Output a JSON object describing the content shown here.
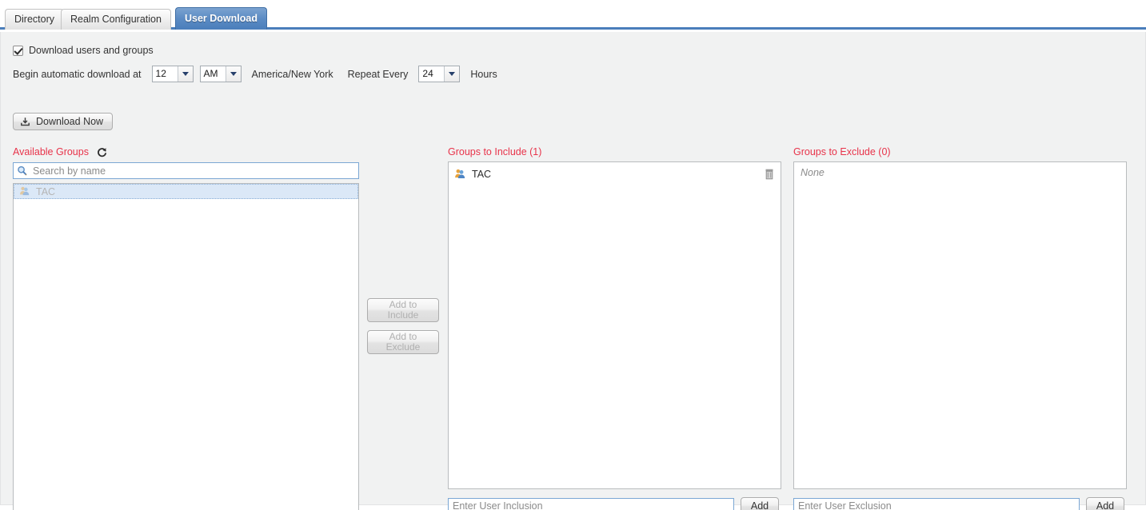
{
  "tabs": [
    {
      "label": "Directory",
      "active": false
    },
    {
      "label": "Realm Configuration",
      "active": false
    },
    {
      "label": "User Download",
      "active": true
    }
  ],
  "options": {
    "download_checkbox_label": "Download users and groups",
    "download_checkbox_checked": true,
    "begin_label": "Begin automatic download at",
    "hour_value": "12",
    "meridiem_value": "AM",
    "timezone": "America/New York",
    "repeat_label": "Repeat Every",
    "repeat_value": "24",
    "hours_label": "Hours",
    "download_now_label": "Download Now",
    "download_now_icon": "download-icon"
  },
  "available": {
    "title": "Available Groups",
    "refresh_icon": "refresh-icon",
    "search_placeholder": "Search by name",
    "search_value": "",
    "search_icon": "search-icon",
    "items": [
      {
        "name": "TAC",
        "icon": "group-icon",
        "selected": true,
        "disabled": true
      }
    ]
  },
  "middle_buttons": {
    "add_to_include": "Add to Include",
    "add_to_include_line1": "Add to",
    "add_to_include_line2": "Include",
    "add_to_include_disabled": true,
    "add_to_exclude": "Add to Exclude",
    "add_to_exclude_line1": "Add to",
    "add_to_exclude_line2": "Exclude",
    "add_to_exclude_disabled": true
  },
  "include": {
    "title": "Groups to Include (1)",
    "count": 1,
    "items": [
      {
        "name": "TAC",
        "icon": "group-icon",
        "delete_icon": "trash-icon"
      }
    ],
    "input_placeholder": "Enter User Inclusion",
    "input_value": "",
    "add_label": "Add"
  },
  "exclude": {
    "title": "Groups to Exclude (0)",
    "count": 0,
    "items": [],
    "empty_text": "None",
    "input_placeholder": "Enter User Exclusion",
    "input_value": "",
    "add_label": "Add"
  },
  "colors": {
    "header_red": "#e8334a",
    "tab_active_blue": "#4a7ebb",
    "panel_bg": "#f1f2f2"
  }
}
